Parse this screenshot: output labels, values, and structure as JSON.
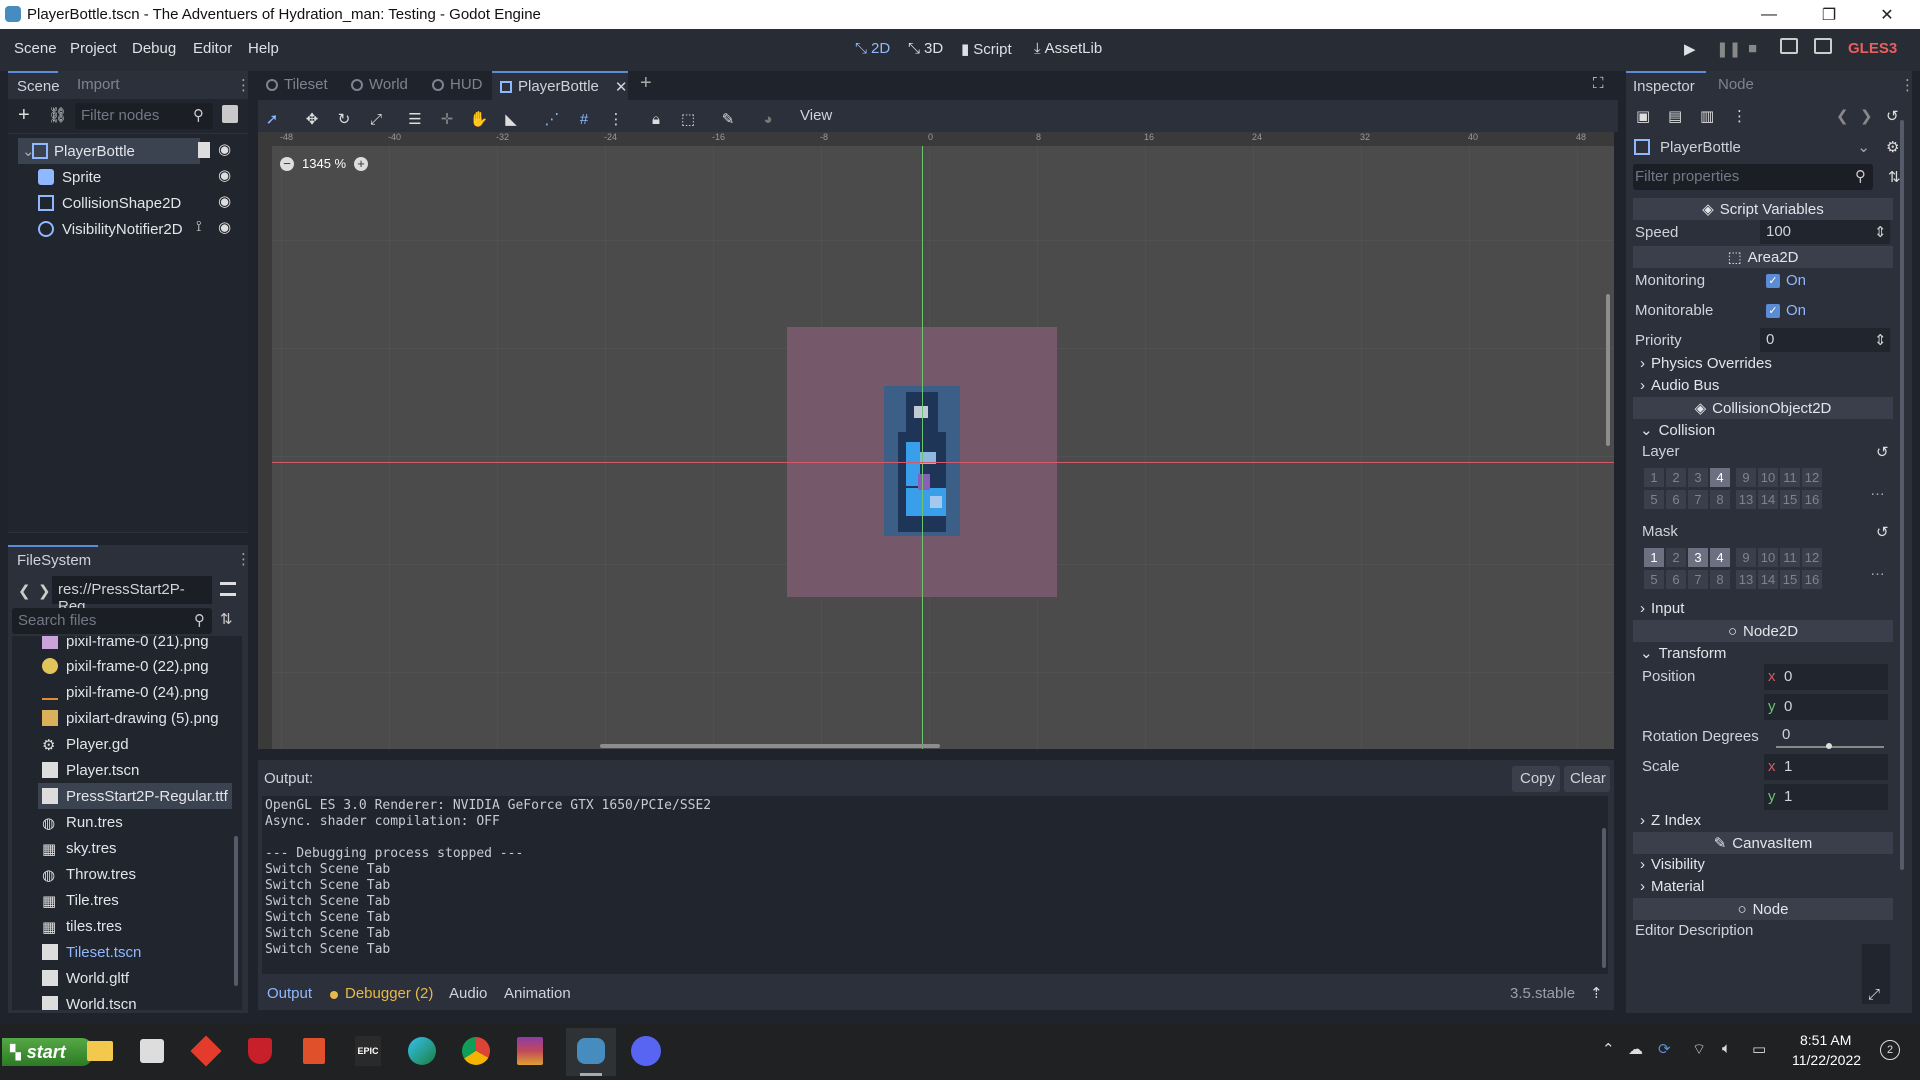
{
  "window": {
    "title": "PlayerBottle.tscn - The Adventuers of Hydration_man: Testing - Godot Engine",
    "controls": [
      "—",
      "❐",
      "✕"
    ]
  },
  "menubar": {
    "items": [
      "Scene",
      "Project",
      "Debug",
      "Editor",
      "Help"
    ],
    "modes": [
      "2D",
      "3D",
      "Script",
      "AssetLib"
    ],
    "renderer": "GLES3"
  },
  "scene_dock": {
    "tabs": [
      "Scene",
      "Import"
    ],
    "filter_placeholder": "Filter nodes",
    "nodes": [
      "PlayerBottle",
      "Sprite",
      "CollisionShape2D",
      "VisibilityNotifier2D"
    ]
  },
  "filesystem": {
    "title": "FileSystem",
    "path": "res://PressStart2P-Reg",
    "search_placeholder": "Search files",
    "files": [
      "pixil-frame-0 (21).png",
      "pixil-frame-0 (22).png",
      "pixil-frame-0 (24).png",
      "pixilart-drawing (5).png",
      "Player.gd",
      "Player.tscn",
      "PressStart2P-Regular.ttf",
      "Run.tres",
      "sky.tres",
      "Throw.tres",
      "Tile.tres",
      "tiles.tres",
      "Tileset.tscn",
      "World.gltf",
      "World.tscn"
    ]
  },
  "editor_tabs": [
    "Tileset",
    "World",
    "HUD",
    "PlayerBottle"
  ],
  "viewport": {
    "view_menu": "View",
    "zoom": "1345 %",
    "ruler_labels": [
      "-48",
      "-40",
      "-32",
      "-24",
      "-16",
      "-8",
      "0",
      "8",
      "16",
      "24",
      "32",
      "40",
      "48"
    ]
  },
  "output": {
    "title": "Output:",
    "copy": "Copy",
    "clear": "Clear",
    "lines": [
      "OpenGL ES 3.0 Renderer: NVIDIA GeForce GTX 1650/PCIe/SSE2",
      "Async. shader compilation: OFF",
      "",
      "--- Debugging process stopped ---",
      "Switch Scene Tab",
      "Switch Scene Tab",
      "Switch Scene Tab",
      "Switch Scene Tab",
      "Switch Scene Tab",
      "Switch Scene Tab"
    ],
    "bottom_tabs": [
      "Output",
      "Debugger (2)",
      "Audio",
      "Animation"
    ],
    "version": "3.5.stable"
  },
  "inspector": {
    "tabs": [
      "Inspector",
      "Node"
    ],
    "object": "PlayerBottle",
    "filter_placeholder": "Filter properties",
    "script_variables": "Script Variables",
    "speed_label": "Speed",
    "speed_value": "100",
    "area2d": "Area2D",
    "monitoring_label": "Monitoring",
    "monitorable_label": "Monitorable",
    "on": "On",
    "priority_label": "Priority",
    "priority_value": "0",
    "physics_overrides": "Physics Overrides",
    "audio_bus": "Audio Bus",
    "collision_object": "CollisionObject2D",
    "collision": "Collision",
    "layer_label": "Layer",
    "mask_label": "Mask",
    "bits_row1": [
      "1",
      "2",
      "3",
      "4",
      "9",
      "10",
      "11",
      "12"
    ],
    "bits_row2": [
      "5",
      "6",
      "7",
      "8",
      "13",
      "14",
      "15",
      "16"
    ],
    "layer_active": [
      "4"
    ],
    "mask_active": [
      "1",
      "3",
      "4"
    ],
    "input": "Input",
    "node2d": "Node2D",
    "transform": "Transform",
    "position_label": "Position",
    "pos_x": "0",
    "pos_y": "0",
    "rotation_label": "Rotation Degrees",
    "rotation_value": "0",
    "scale_label": "Scale",
    "scale_x": "1",
    "scale_y": "1",
    "x": "x",
    "y": "y",
    "z_index": "Z Index",
    "canvas_item": "CanvasItem",
    "visibility": "Visibility",
    "material": "Material",
    "node": "Node",
    "editor_description": "Editor Description"
  },
  "taskbar": {
    "start": "start",
    "time": "8:51 AM",
    "date": "11/22/2022",
    "badge": "2",
    "epic": "EPIC"
  }
}
